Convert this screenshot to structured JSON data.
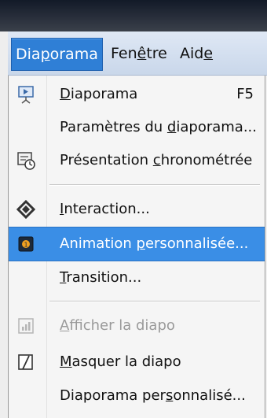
{
  "menubar": {
    "menus": [
      {
        "pre": "Dia",
        "ul": "p",
        "post": "orama"
      },
      {
        "pre": "Fen",
        "ul": "ê",
        "post": "tre"
      },
      {
        "pre": "Aid",
        "ul": "e",
        "post": ""
      }
    ]
  },
  "dropdown": {
    "items": [
      {
        "pre": "",
        "ul": "D",
        "post": "iaporama",
        "shortcut": "F5",
        "icon": "slideshow-icon"
      },
      {
        "pre": "Paramètres du ",
        "ul": "d",
        "post": "iaporama...",
        "icon": ""
      },
      {
        "pre": "Présentation ",
        "ul": "c",
        "post": "hronométrée",
        "icon": "rehearse-timings-icon"
      },
      {
        "pre": "",
        "ul": "I",
        "post": "nteraction...",
        "icon": "interaction-icon"
      },
      {
        "pre": "Animation ",
        "ul": "p",
        "post": "ersonnalisée...",
        "icon": "custom-animation-icon"
      },
      {
        "pre": "",
        "ul": "T",
        "post": "ransition...",
        "icon": ""
      },
      {
        "pre": "",
        "ul": "A",
        "post": "fficher la diapo",
        "icon": "show-slide-icon"
      },
      {
        "pre": "",
        "ul": "M",
        "post": "asquer la diapo",
        "icon": "hide-slide-icon"
      },
      {
        "pre": "Diaporama per",
        "ul": "s",
        "post": "onnalisé...",
        "icon": ""
      }
    ]
  },
  "colors": {
    "highlight": "#3a8ee6",
    "menubar_active": "#2f7fd6",
    "disabled_text": "#9a9a9a"
  }
}
